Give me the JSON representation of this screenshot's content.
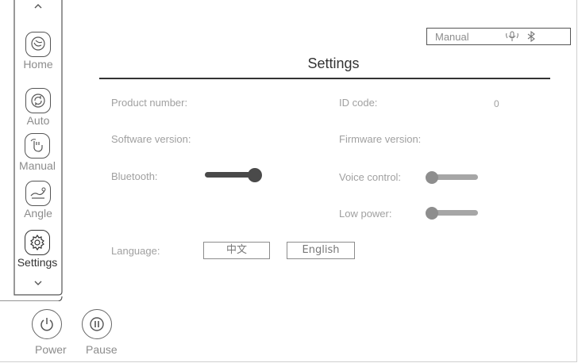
{
  "status_bar": {
    "mode": "Manual",
    "icons": [
      "voice-icon",
      "bluetooth-icon"
    ]
  },
  "sidebar": {
    "scroll_up_icon": "chevron-up-icon",
    "scroll_down_icon": "chevron-down-icon",
    "items": [
      {
        "label": "Home",
        "icon": "home-hand-icon",
        "active": false
      },
      {
        "label": "Auto",
        "icon": "auto-cycle-icon",
        "active": false
      },
      {
        "label": "Manual",
        "icon": "manual-hand-icon",
        "active": false
      },
      {
        "label": "Angle",
        "icon": "angle-recline-icon",
        "active": false
      },
      {
        "label": "Settings",
        "icon": "gear-icon",
        "active": true
      }
    ]
  },
  "controls": {
    "power_label": "Power",
    "pause_label": "Pause"
  },
  "settings": {
    "title": "Settings",
    "product_number_label": "Product number:",
    "id_code_label": "ID code:",
    "id_code_value": "0",
    "software_version_label": "Software version:",
    "firmware_version_label": "Firmware version:",
    "bluetooth_label": "Bluetooth:",
    "bluetooth_on": true,
    "voice_control_label": "Voice control:",
    "voice_control_on": false,
    "low_power_label": "Low power:",
    "low_power_on": false,
    "language_label": "Language:",
    "language_options": [
      "中文",
      "English"
    ]
  }
}
